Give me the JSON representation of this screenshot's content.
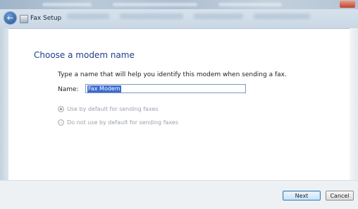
{
  "window": {
    "nav_title": "Fax Setup"
  },
  "page": {
    "heading": "Choose a modem name",
    "instruction": "Type a name that will help you identify this modem when sending a fax.",
    "name_label": "Name:",
    "name_value": "Fax Modem",
    "options": [
      {
        "label": "Use by default for sending faxes",
        "selected": true
      },
      {
        "label": "Do not use by default for sending faxes",
        "selected": false
      }
    ]
  },
  "footer": {
    "next_label": "Next",
    "cancel_label": "Cancel"
  },
  "colors": {
    "heading": "#1e3f8a",
    "selection": "#3b6ad0",
    "accent_border": "#3c7fb1"
  },
  "icons": {
    "back": "back-arrow-icon",
    "app": "fax-icon",
    "close": "close-icon"
  }
}
